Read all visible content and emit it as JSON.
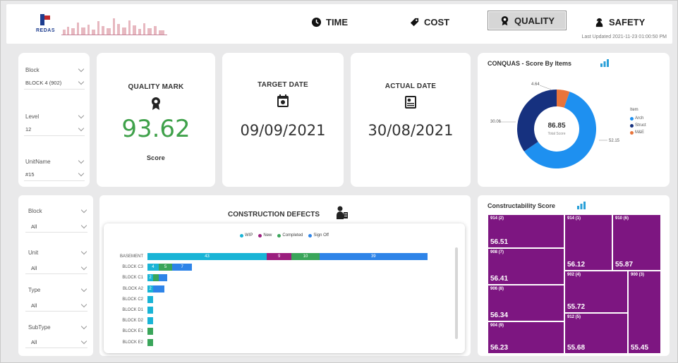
{
  "header": {
    "logo_text": "REDAS",
    "nav": [
      {
        "label": "TIME",
        "icon": "clock-icon"
      },
      {
        "label": "COST",
        "icon": "tag-icon"
      },
      {
        "label": "QUALITY",
        "icon": "award-icon"
      },
      {
        "label": "SAFETY",
        "icon": "person-safety-icon"
      }
    ],
    "active_nav": "QUALITY",
    "last_updated": "Last Updated 2021-11-23 01:00:50 PM"
  },
  "filters_top": {
    "block": {
      "label": "Block",
      "value": "BLOCK 4 (902)"
    },
    "level": {
      "label": "Level",
      "value": "12"
    },
    "unit": {
      "label": "UnitName",
      "value": "#15"
    }
  },
  "kpis": {
    "quality": {
      "title": "QUALITY MARK",
      "value": "93.62",
      "caption": "Score",
      "icon": "award-icon"
    },
    "target": {
      "title": "TARGET DATE",
      "value": "09/09/2021",
      "icon": "calendar-icon"
    },
    "actual": {
      "title": "ACTUAL DATE",
      "value": "30/08/2021",
      "icon": "document-icon"
    }
  },
  "conquas": {
    "title": "CONQUAS - Score By Items",
    "center_value": "86.85",
    "center_label": "Total Score",
    "legend_title": "Item",
    "labels": [
      "4.64",
      "30.06",
      "52.15"
    ],
    "chart_data": {
      "type": "pie",
      "categories": [
        "Arch",
        "Struct",
        "M&E"
      ],
      "values": [
        52.15,
        30.06,
        4.64
      ],
      "colors": [
        "#1e90f0",
        "#16317f",
        "#e8743b"
      ],
      "legend_position": "right"
    }
  },
  "filters_bottom": {
    "block": {
      "label": "Block",
      "value": "All"
    },
    "unit": {
      "label": "Unit",
      "value": "All"
    },
    "type": {
      "label": "Type",
      "value": "All"
    },
    "subtype": {
      "label": "SubType",
      "value": "All"
    }
  },
  "defects": {
    "title": "CONSTRUCTION DEFECTS",
    "chart_data": {
      "type": "bar",
      "orientation": "horizontal",
      "stacked": true,
      "categories": [
        "BASEMENT",
        "BLOCK C3",
        "BLOCK C1",
        "BLOCK A2",
        "BLOCK C2",
        "BLOCK D1",
        "BLOCK D2",
        "BLOCK E1",
        "BLOCK E2"
      ],
      "legend_position": "top",
      "series": [
        {
          "name": "WIP",
          "color": "#19b4d6",
          "values": [
            43,
            4,
            2,
            2,
            1,
            1,
            1,
            0,
            0
          ],
          "labels": [
            "43",
            "4",
            "2",
            "2",
            "",
            "",
            "",
            "",
            ""
          ]
        },
        {
          "name": "New",
          "color": "#9b1e7e",
          "values": [
            9,
            0,
            0,
            0,
            0,
            0,
            0,
            0,
            0
          ],
          "labels": [
            "9",
            "",
            "",
            "",
            "",
            "",
            "",
            "",
            ""
          ]
        },
        {
          "name": "Completed",
          "color": "#3aa55a",
          "values": [
            10,
            5,
            1,
            0,
            0,
            0,
            0,
            1,
            1
          ],
          "labels": [
            "10",
            "5",
            "",
            "",
            "",
            "",
            "",
            "",
            ""
          ]
        },
        {
          "name": "Sign Off",
          "color": "#2e84e8",
          "values": [
            39,
            7,
            3,
            4,
            0,
            0,
            0,
            0,
            0
          ],
          "labels": [
            "39",
            "7",
            "",
            "",
            "",
            "",
            "",
            "",
            ""
          ]
        }
      ]
    }
  },
  "constructability": {
    "title": "Constructability Score",
    "chart_data": {
      "type": "heatmap",
      "subtype": "treemap",
      "items": [
        {
          "label": "914 (2)",
          "value": 56.51
        },
        {
          "label": "914 (1)",
          "value": 56.12
        },
        {
          "label": "910 (6)",
          "value": 55.87
        },
        {
          "label": "908 (7)",
          "value": 56.41
        },
        {
          "label": "902 (4)",
          "value": 55.72
        },
        {
          "label": "900 (3)",
          "value": 55.45
        },
        {
          "label": "906 (8)",
          "value": 56.34
        },
        {
          "label": "912 (5)",
          "value": 55.68
        },
        {
          "label": "904 (9)",
          "value": 56.23
        }
      ],
      "color": "#7d1681"
    },
    "display_values": [
      "56.51",
      "56.12",
      "55.87",
      "56.41",
      "55.72",
      "55.45",
      "56.34",
      "55.68",
      "56.23"
    ]
  }
}
